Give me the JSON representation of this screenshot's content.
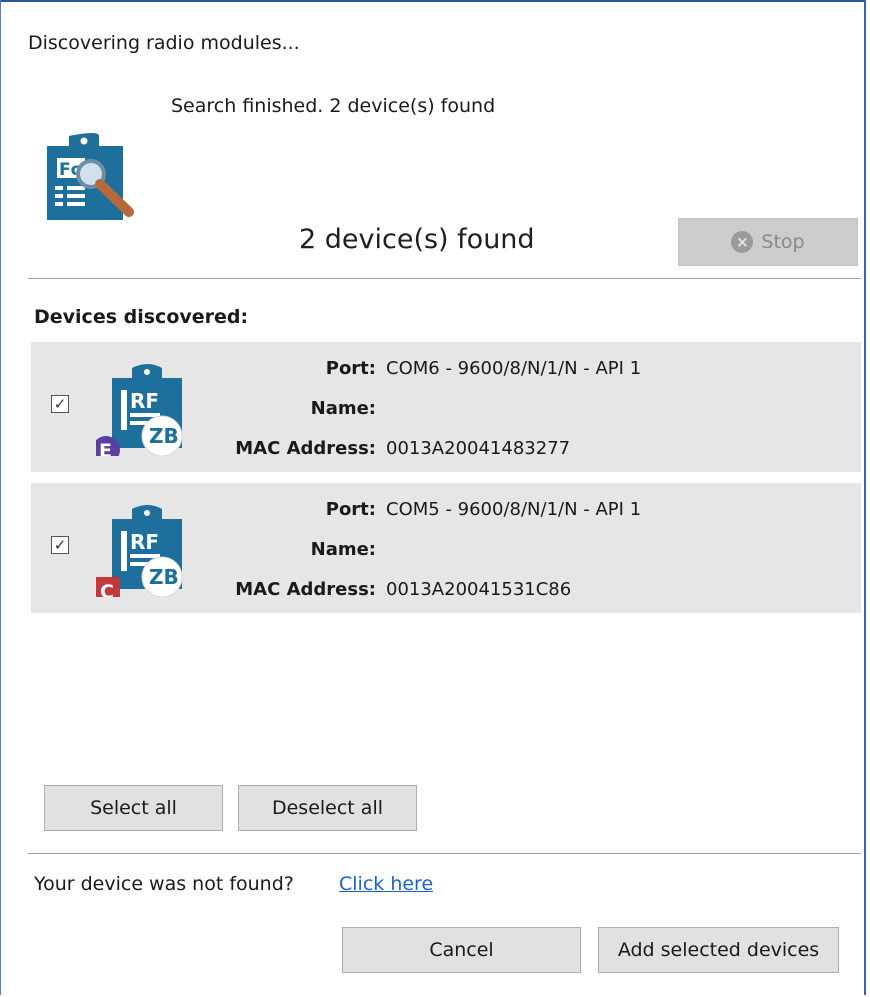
{
  "dialog": {
    "title": "Discovering radio modules...",
    "status": "Search finished. 2 device(s) found",
    "count_label": "2 device(s) found",
    "stop_label": "Stop"
  },
  "devices_section": {
    "heading": "Devices discovered:",
    "labels": {
      "port": "Port:",
      "name": "Name:",
      "mac": "MAC Address:"
    },
    "devices": [
      {
        "checked": true,
        "port": "COM6 - 9600/8/N/1/N - API 1",
        "name": "",
        "mac": "0013A20041483277",
        "icon_main": "RF",
        "badge_letter": "E",
        "badge_color": "#5b3f9e",
        "protocol": "ZB"
      },
      {
        "checked": true,
        "port": "COM5 - 9600/8/N/1/N - API 1",
        "name": "",
        "mac": "0013A20041531C86",
        "icon_main": "RF",
        "badge_letter": "C",
        "badge_color": "#c0393b",
        "protocol": "ZB"
      }
    ]
  },
  "selection": {
    "select_all": "Select all",
    "deselect_all": "Deselect all"
  },
  "footer": {
    "not_found_text": "Your device was not found?",
    "link_text": "Click here",
    "cancel_label": "Cancel",
    "add_label": "Add selected devices"
  },
  "colors": {
    "module_blue": "#1e6f9c",
    "link": "#1a64c8"
  }
}
